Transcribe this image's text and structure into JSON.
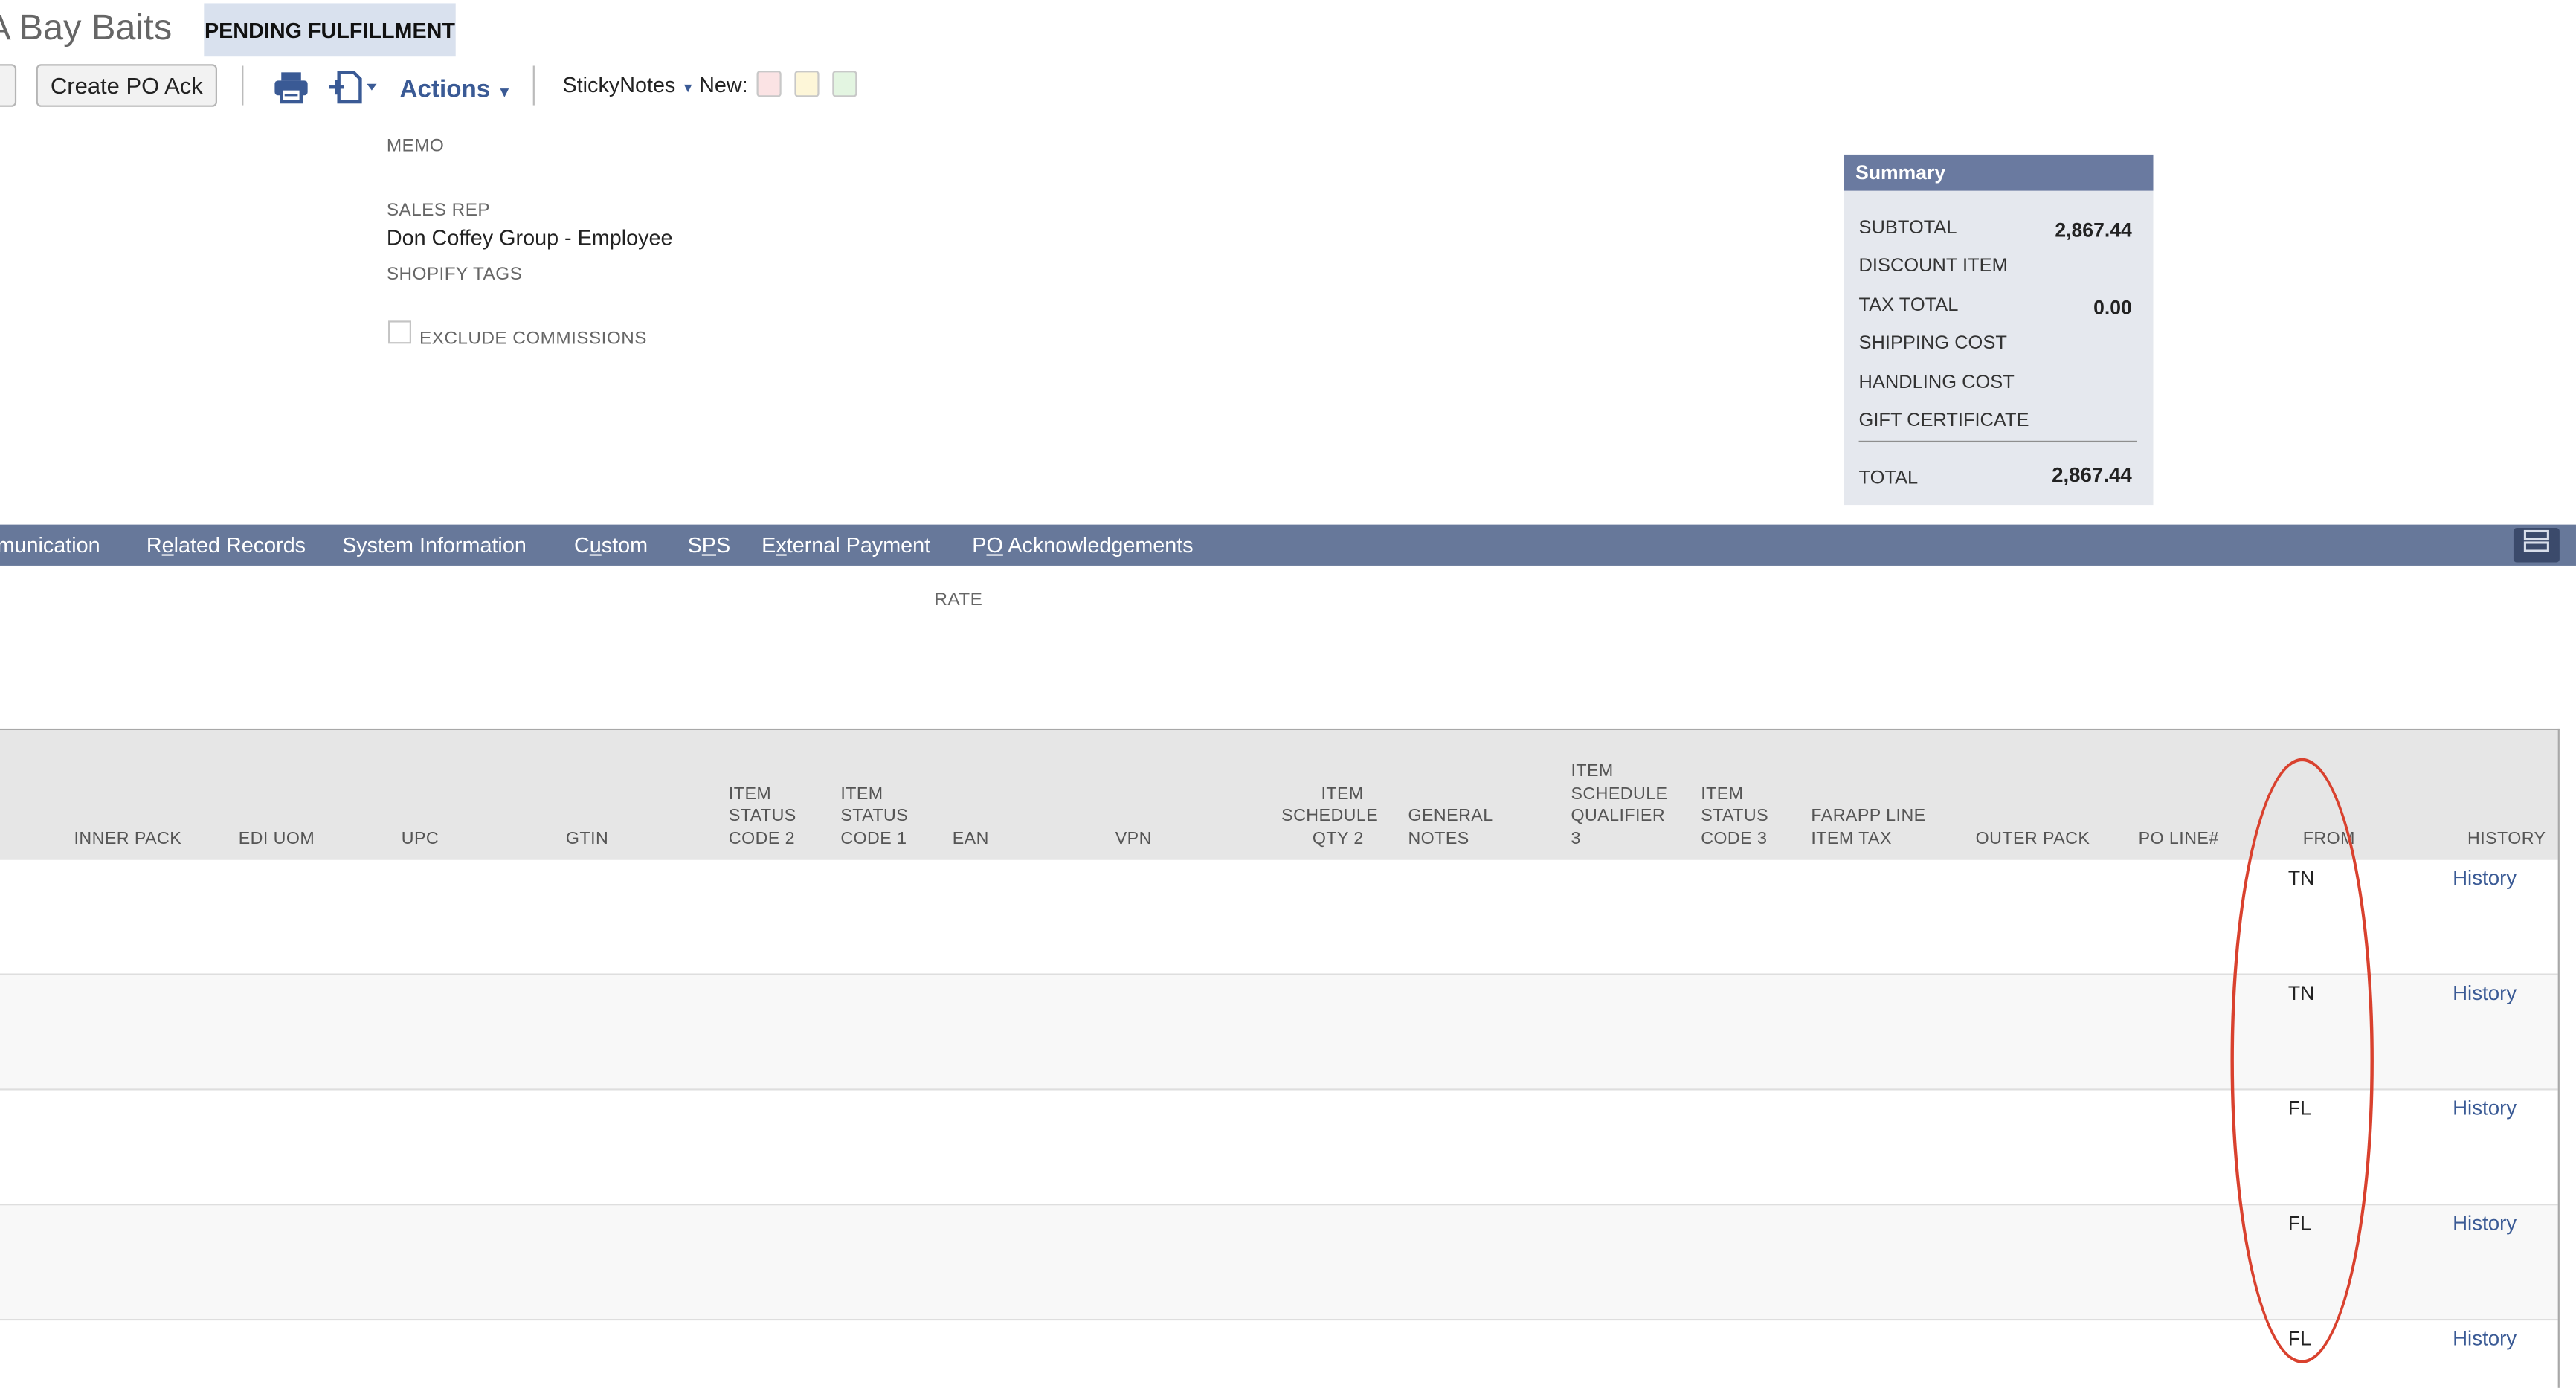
{
  "header": {
    "record_title": "A Bay Baits",
    "status": "PENDING FULFILLMENT"
  },
  "toolbar": {
    "create_po_ack_label": "Create PO Ack",
    "actions_label": "Actions",
    "sticky_notes_label": "StickyNotes",
    "new_label": "New:",
    "note_colors": [
      "#fbe3e4",
      "#fdf6d8",
      "#e3f5e1"
    ]
  },
  "fields": {
    "memo_label": "MEMO",
    "sales_rep_label": "SALES REP",
    "sales_rep_value": "Don Coffey Group - Employee",
    "shopify_tags_label": "SHOPIFY TAGS",
    "exclude_commissions_label": "EXCLUDE COMMISSIONS"
  },
  "summary": {
    "title": "Summary",
    "subtotal_label": "SUBTOTAL",
    "subtotal_value": "2,867.44",
    "discount_label": "DISCOUNT ITEM",
    "tax_label": "TAX TOTAL",
    "tax_value": "0.00",
    "shipping_label": "SHIPPING COST",
    "handling_label": "HANDLING COST",
    "gift_label": "GIFT CERTIFICATE",
    "total_label": "TOTAL",
    "total_value": "2,867.44"
  },
  "tabs": {
    "communication": "munication",
    "related_records": "Related Records",
    "system_information": "System Information",
    "custom": "Custom",
    "sps": "SPS",
    "external_payment": "External Payment",
    "po_acknowledgements": "PO Acknowledgements"
  },
  "rate_label": "RATE",
  "columns": {
    "inner_pack": [
      "INNER PACK"
    ],
    "edi_uom": [
      "EDI UOM"
    ],
    "upc": [
      "UPC"
    ],
    "gtin": [
      "GTIN"
    ],
    "item_status_code_2": [
      "ITEM",
      "STATUS",
      "CODE 2"
    ],
    "item_status_code_1": [
      "ITEM",
      "STATUS",
      "CODE 1"
    ],
    "ean": [
      "EAN"
    ],
    "vpn": [
      "VPN"
    ],
    "item_schedule_qty_2": [
      "ITEM",
      "SCHEDULE",
      "QTY 2"
    ],
    "general_notes": [
      "GENERAL",
      "NOTES"
    ],
    "item_schedule_qualifier_3": [
      "ITEM",
      "SCHEDULE",
      "QUALIFIER",
      "3"
    ],
    "item_status_code_3": [
      "ITEM",
      "STATUS",
      "CODE 3"
    ],
    "farapp_line_item_tax": [
      "FARAPP LINE",
      "ITEM TAX"
    ],
    "outer_pack": [
      "OUTER PACK"
    ],
    "po_line": [
      "PO LINE#"
    ],
    "from": [
      "FROM"
    ],
    "history": [
      "HISTORY"
    ]
  },
  "rows": [
    {
      "from": "TN",
      "history": "History"
    },
    {
      "from": "TN",
      "history": "History"
    },
    {
      "from": "FL",
      "history": "History"
    },
    {
      "from": "FL",
      "history": "History"
    },
    {
      "from": "FL",
      "history": "History"
    }
  ],
  "colors": {
    "tab_bar": "#67789a",
    "summary_header": "#6a7aa0",
    "link": "#3a5a95",
    "annotation": "#d9412e"
  }
}
